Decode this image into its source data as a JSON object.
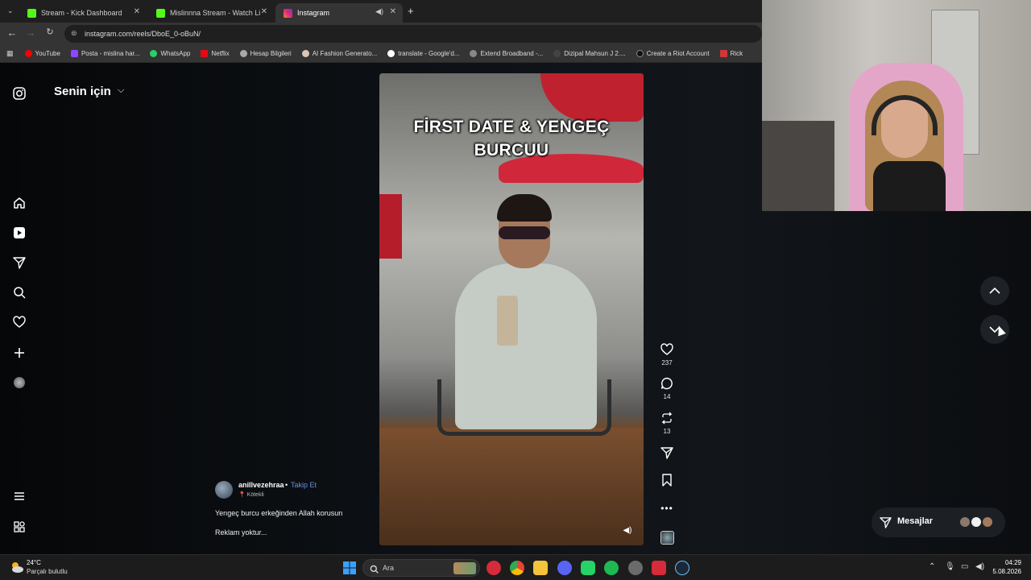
{
  "browser": {
    "tabs": [
      {
        "title": "Stream - Kick Dashboard",
        "color": "#53fc18"
      },
      {
        "title": "Mislinnna Stream - Watch Live",
        "color": "#53fc18"
      },
      {
        "title": "Instagram",
        "color": "#e1306c"
      }
    ],
    "url": "instagram.com/reels/DboE_0-oBuN/",
    "bookmarks": [
      {
        "label": "YouTube",
        "color": "#ff0000"
      },
      {
        "label": "Posta - mislina har...",
        "color": "#3a7bd5"
      },
      {
        "label": "WhatsApp",
        "color": "#25d366"
      },
      {
        "label": "Netflix",
        "color": "#e50914"
      },
      {
        "label": "Hesap Bilgileri",
        "color": "#aaaaaa"
      },
      {
        "label": "AI Fashion Generato...",
        "color": "#d9c7b5"
      },
      {
        "label": "translate - Google'd...",
        "color": "#ffffff"
      },
      {
        "label": "Extend Broadband -...",
        "color": "#888888"
      },
      {
        "label": "Dizipal Mahsun J 2....",
        "color": "#222222"
      },
      {
        "label": "Create a Riot Account",
        "color": "#d13639"
      },
      {
        "label": "Rick",
        "color": "#d13639"
      }
    ]
  },
  "instagram": {
    "feed_title": "Senin için",
    "video_caption_line1": "FİRST DATE & YENGEÇ",
    "video_caption_line2": "BURCUU",
    "likes": "237",
    "comments": "14",
    "reposts": "13",
    "author": "anillvezehraa",
    "separator": "•",
    "follow_label": "Takip Et",
    "location": "Kötekli",
    "caption": "Yengeç burcu erkeğinden Allah korusun",
    "ad_text": "Reklam yoktur...",
    "messages_label": "Mesajlar"
  },
  "taskbar": {
    "temperature": "24°C",
    "weather_desc": "Parçalı bulutlu",
    "search_placeholder": "Ara",
    "time": "04:29",
    "date": "5.08.2026"
  }
}
